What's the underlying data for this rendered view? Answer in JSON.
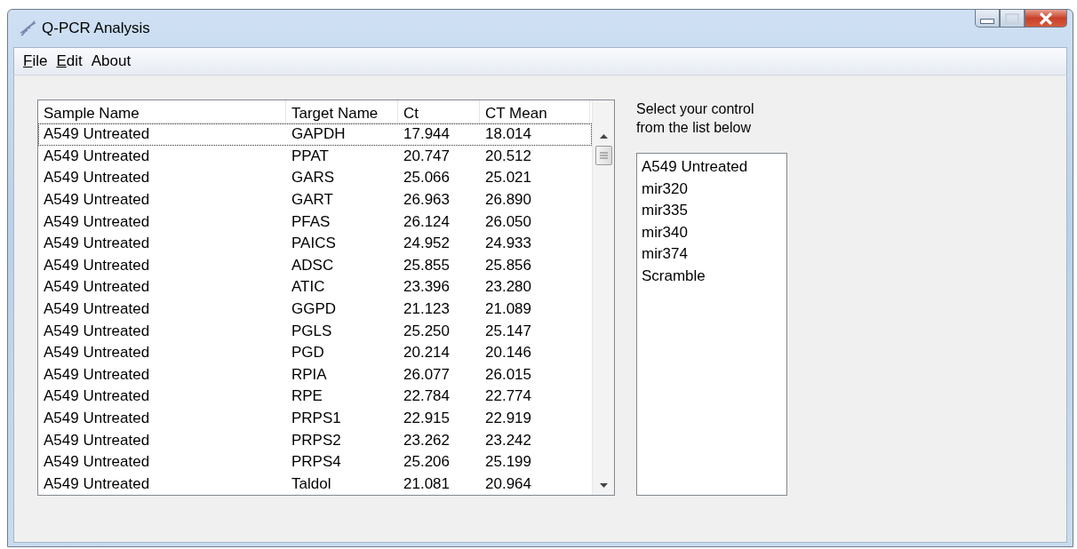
{
  "window": {
    "title": "Q-PCR Analysis"
  },
  "menu": [
    {
      "label": "File",
      "mnemonic": true
    },
    {
      "label": "Edit",
      "mnemonic": true
    },
    {
      "label": "About",
      "mnemonic": false
    }
  ],
  "table": {
    "columns": [
      "Sample Name",
      "Target Name",
      "Ct",
      "CT Mean"
    ],
    "rows": [
      {
        "cells": [
          "A549 Untreated",
          "GAPDH",
          "17.944",
          "18.014"
        ],
        "focused": true
      },
      {
        "cells": [
          "A549 Untreated",
          "PPAT",
          "20.747",
          "20.512"
        ],
        "focused": false
      },
      {
        "cells": [
          "A549 Untreated",
          "GARS",
          "25.066",
          "25.021"
        ],
        "focused": false
      },
      {
        "cells": [
          "A549 Untreated",
          "GART",
          "26.963",
          "26.890"
        ],
        "focused": false
      },
      {
        "cells": [
          "A549 Untreated",
          "PFAS",
          "26.124",
          "26.050"
        ],
        "focused": false
      },
      {
        "cells": [
          "A549 Untreated",
          "PAICS",
          "24.952",
          "24.933"
        ],
        "focused": false
      },
      {
        "cells": [
          "A549 Untreated",
          "ADSC",
          "25.855",
          "25.856"
        ],
        "focused": false
      },
      {
        "cells": [
          "A549 Untreated",
          "ATIC",
          "23.396",
          "23.280"
        ],
        "focused": false
      },
      {
        "cells": [
          "A549 Untreated",
          "GGPD",
          "21.123",
          "21.089"
        ],
        "focused": false
      },
      {
        "cells": [
          "A549 Untreated",
          "PGLS",
          "25.250",
          "25.147"
        ],
        "focused": false
      },
      {
        "cells": [
          "A549 Untreated",
          "PGD",
          "20.214",
          "20.146"
        ],
        "focused": false
      },
      {
        "cells": [
          "A549 Untreated",
          "RPIA",
          "26.077",
          "26.015"
        ],
        "focused": false
      },
      {
        "cells": [
          "A549 Untreated",
          "RPE",
          "22.784",
          "22.774"
        ],
        "focused": false
      },
      {
        "cells": [
          "A549 Untreated",
          "PRPS1",
          "22.915",
          "22.919"
        ],
        "focused": false
      },
      {
        "cells": [
          "A549 Untreated",
          "PRPS2",
          "23.262",
          "23.242"
        ],
        "focused": false
      },
      {
        "cells": [
          "A549 Untreated",
          "PRPS4",
          "25.206",
          "25.199"
        ],
        "focused": false
      },
      {
        "cells": [
          "A549 Untreated",
          "Taldol",
          "21.081",
          "20.964"
        ],
        "focused": false
      }
    ]
  },
  "control_panel": {
    "label": "Select your control\nfrom the list below",
    "items": [
      "A549 Untreated",
      "mir320",
      "mir335",
      "mir340",
      "mir374",
      "Scramble"
    ]
  }
}
